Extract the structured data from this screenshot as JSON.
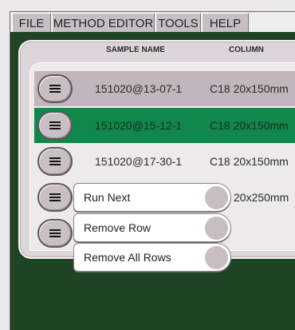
{
  "menubar": {
    "items": [
      "FILE",
      "METHOD EDITOR",
      "TOOLS",
      "HELP"
    ]
  },
  "table": {
    "headers": {
      "sample_name": "SAMPLE NAME",
      "column": "COLUMN"
    },
    "rows": [
      {
        "sample_name": "151020@13-07-1",
        "column": "C18 20x150mm",
        "state": "normal"
      },
      {
        "sample_name": "151020@15-12-1",
        "column": "C18 20x150mm",
        "state": "selected"
      },
      {
        "sample_name": "151020@17-30-1",
        "column": "C18 20x150mm",
        "state": "plain"
      },
      {
        "sample_name": "",
        "column": "20x250mm",
        "state": "plain"
      }
    ]
  },
  "context_menu": {
    "items": [
      "Run Next",
      "Remove Row",
      "Remove All Rows"
    ]
  },
  "colors": {
    "workspace_bg": "#1e4424",
    "selected_row": "#10874b",
    "normal_row": "#c1b6bb"
  }
}
